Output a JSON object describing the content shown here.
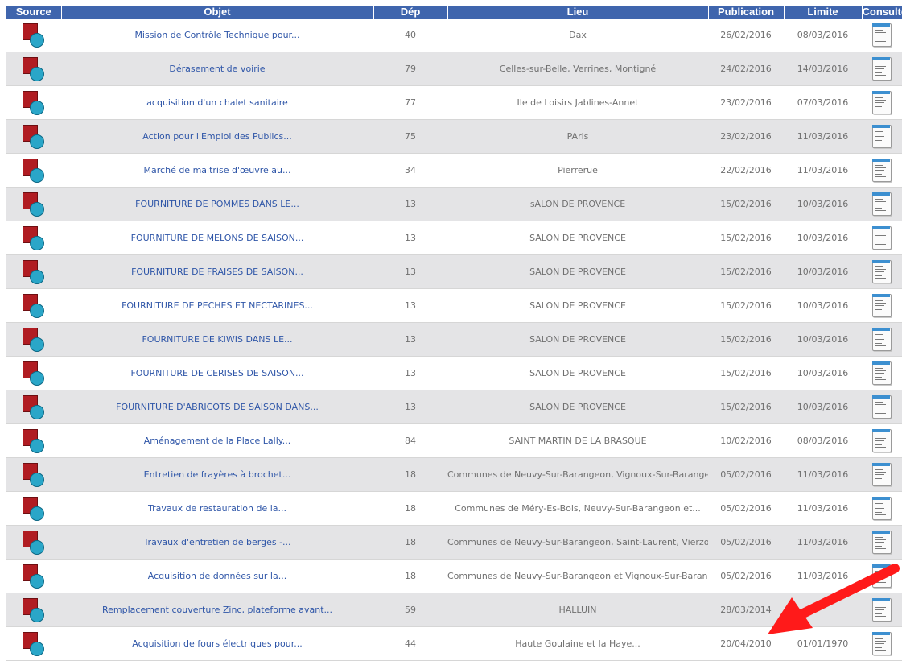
{
  "table": {
    "headers": {
      "source": "Source",
      "objet": "Objet",
      "dep": "Dép",
      "lieu": "Lieu",
      "publication": "Publication",
      "limite": "Limite",
      "consulter": "Consulter"
    },
    "rows": [
      {
        "objet": "Mission de Contrôle Technique pour...",
        "dep": "40",
        "lieu": "Dax",
        "publication": "26/02/2016",
        "limite": "08/03/2016"
      },
      {
        "objet": "Dérasement de voirie",
        "dep": "79",
        "lieu": "Celles-sur-Belle, Verrines, Montigné",
        "publication": "24/02/2016",
        "limite": "14/03/2016"
      },
      {
        "objet": "acquisition d'un chalet sanitaire",
        "dep": "77",
        "lieu": "Ile de Loisirs Jablines-Annet",
        "publication": "23/02/2016",
        "limite": "07/03/2016"
      },
      {
        "objet": "Action pour l'Emploi des Publics...",
        "dep": "75",
        "lieu": "PAris",
        "publication": "23/02/2016",
        "limite": "11/03/2016"
      },
      {
        "objet": "Marché de maitrise d'œuvre au...",
        "dep": "34",
        "lieu": "Pierrerue",
        "publication": "22/02/2016",
        "limite": "11/03/2016"
      },
      {
        "objet": "FOURNITURE DE POMMES DANS LE...",
        "dep": "13",
        "lieu": "sALON DE PROVENCE",
        "publication": "15/02/2016",
        "limite": "10/03/2016"
      },
      {
        "objet": "FOURNITURE DE MELONS DE SAISON...",
        "dep": "13",
        "lieu": "SALON DE PROVENCE",
        "publication": "15/02/2016",
        "limite": "10/03/2016"
      },
      {
        "objet": "FOURNITURE DE FRAISES DE SAISON...",
        "dep": "13",
        "lieu": "SALON DE PROVENCE",
        "publication": "15/02/2016",
        "limite": "10/03/2016"
      },
      {
        "objet": "FOURNITURE DE PECHES ET NECTARINES...",
        "dep": "13",
        "lieu": "SALON DE PROVENCE",
        "publication": "15/02/2016",
        "limite": "10/03/2016"
      },
      {
        "objet": "FOURNITURE DE KIWIS DANS LE...",
        "dep": "13",
        "lieu": "SALON DE PROVENCE",
        "publication": "15/02/2016",
        "limite": "10/03/2016"
      },
      {
        "objet": "FOURNITURE DE CERISES DE SAISON...",
        "dep": "13",
        "lieu": "SALON DE PROVENCE",
        "publication": "15/02/2016",
        "limite": "10/03/2016"
      },
      {
        "objet": "FOURNITURE D'ABRICOTS DE SAISON DANS...",
        "dep": "13",
        "lieu": "SALON DE PROVENCE",
        "publication": "15/02/2016",
        "limite": "10/03/2016"
      },
      {
        "objet": "Aménagement de la Place Lally...",
        "dep": "84",
        "lieu": "SAINT MARTIN DE LA BRASQUE",
        "publication": "10/02/2016",
        "limite": "08/03/2016"
      },
      {
        "objet": "Entretien de frayères à brochet...",
        "dep": "18",
        "lieu": "Communes de Neuvy-Sur-Barangeon, Vignoux-Sur-Barangeon et...",
        "publication": "05/02/2016",
        "limite": "11/03/2016"
      },
      {
        "objet": "Travaux de restauration de la...",
        "dep": "18",
        "lieu": "Communes de Méry-Es-Bois, Neuvy-Sur-Barangeon et...",
        "publication": "05/02/2016",
        "limite": "11/03/2016"
      },
      {
        "objet": "Travaux d'entretien de berges -...",
        "dep": "18",
        "lieu": "Communes de Neuvy-Sur-Barangeon, Saint-Laurent, Vierzon,...",
        "publication": "05/02/2016",
        "limite": "11/03/2016"
      },
      {
        "objet": "Acquisition de données sur la...",
        "dep": "18",
        "lieu": "Communes de Neuvy-Sur-Barangeon et Vignoux-Sur-Barangeon",
        "publication": "05/02/2016",
        "limite": "11/03/2016"
      },
      {
        "objet": "Remplacement couverture Zinc, plateforme avant...",
        "dep": "59",
        "lieu": "HALLUIN",
        "publication": "28/03/2014",
        "limite": ""
      },
      {
        "objet": "Acquisition de fours électriques pour...",
        "dep": "44",
        "lieu": "Haute Goulaine et la Haye...",
        "publication": "20/04/2010",
        "limite": "01/01/1970"
      }
    ]
  },
  "icons": {
    "source": "ac-source-icon",
    "consulter": "document-icon",
    "annotation": "red-arrow-annotation"
  },
  "colors": {
    "header_bg": "#3f65ad",
    "link_text": "#2f56a8",
    "row_alt_bg": "#e4e4e6",
    "arrow": "#ff0000"
  }
}
